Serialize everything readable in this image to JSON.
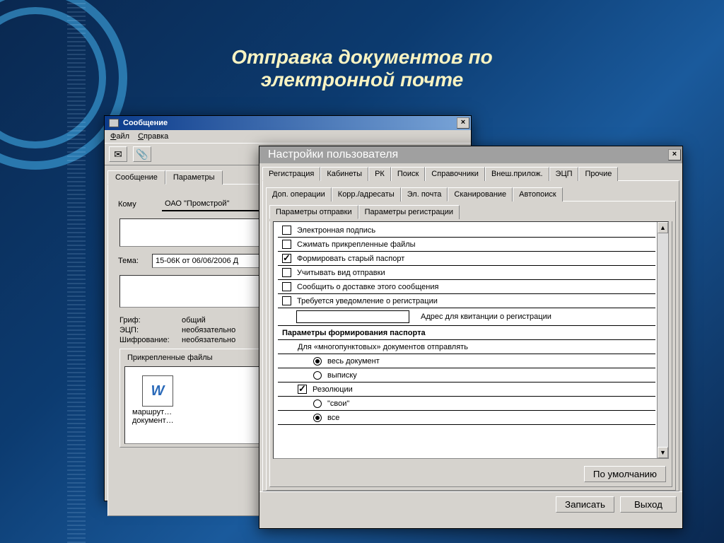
{
  "slide": {
    "title_line1": "Отправка документов по",
    "title_line2": "электронной почте"
  },
  "msg_win": {
    "title": "Сообщение",
    "menu": {
      "file": "Файл",
      "help": "Справка"
    },
    "tabs": {
      "message": "Сообщение",
      "params": "Параметры"
    },
    "labels": {
      "to": "Кому",
      "subject": "Тема:",
      "grif": "Гриф:",
      "ecp": "ЭЦП:",
      "encryption": "Шифрование:",
      "attachments": "Прикрепленные файлы"
    },
    "values": {
      "to": "ОАО \"Промстрой\"",
      "to_addr": "",
      "subject": "15-06К от 06/06/2006 Д",
      "body": "",
      "grif": "общий",
      "ecp": "необязательно",
      "encryption": "необязательно",
      "attachment1": "маршрут…",
      "attachment2": "документ…"
    }
  },
  "settings_win": {
    "title": "Настройки пользователя",
    "main_tabs": [
      "Регистрация",
      "Кабинеты",
      "РК",
      "Поиск",
      "Справочники",
      "Внеш.прилож.",
      "ЭЦП",
      "Прочие"
    ],
    "main_tab_active": 0,
    "sub_tabs": [
      "Доп. операции",
      "Корр./адресаты",
      "Эл. почта",
      "Сканирование",
      "Автопоиск"
    ],
    "sub_tab_active": 2,
    "param_tabs": [
      "Параметры отправки",
      "Параметры регистрации"
    ],
    "param_tab_active": 0,
    "options": {
      "digital_sign": {
        "label": "Электронная подпись",
        "checked": false
      },
      "compress": {
        "label": "Сжимать прикрепленные файлы",
        "checked": false
      },
      "old_passport": {
        "label": "Формировать старый паспорт",
        "checked": true
      },
      "send_type": {
        "label": "Учитывать вид отправки",
        "checked": false
      },
      "delivery": {
        "label": "Сообщить о доставке этого сообщения",
        "checked": false
      },
      "reg_notify": {
        "label": "Требуется уведомление о регистрации",
        "checked": false
      },
      "addr_label": "Адрес для квитанции о регистрации",
      "addr_value": "",
      "passport_heading": "Параметры формирования паспорта",
      "multi_label": "Для «многопунктовых» документов отправлять",
      "radio_doc": {
        "label": "весь документ",
        "checked": true
      },
      "radio_excerpt": {
        "label": "выписку",
        "checked": false
      },
      "resolutions": {
        "label": "Резолюции",
        "checked": true
      },
      "radio_own": {
        "label": "\"свои\"",
        "checked": false
      },
      "radio_all": {
        "label": "все",
        "checked": true
      }
    },
    "buttons": {
      "defaults": "По умолчанию",
      "save": "Записать",
      "exit": "Выход"
    }
  }
}
